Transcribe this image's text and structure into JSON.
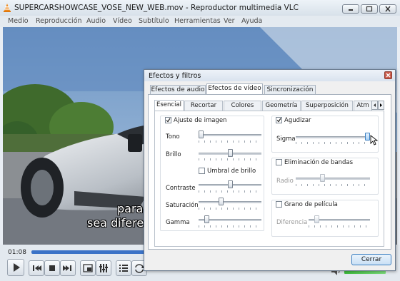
{
  "window": {
    "title": "SUPERCARSHOWCASE_VOSE_NEW_WEB.mov - Reproductor multimedia VLC"
  },
  "menu": {
    "items": [
      "Medio",
      "Reproducción",
      "Audio",
      "Vídeo",
      "Subtítulo",
      "Herramientas",
      "Ver",
      "Ayuda"
    ]
  },
  "video": {
    "subtitle_lines": [
      "para",
      "sea difere"
    ]
  },
  "player": {
    "time_elapsed": "01:08",
    "volume_level": 1.0
  },
  "dialog": {
    "title": "Efectos y filtros",
    "tabs": [
      "Efectos de audio",
      "Efectos de vídeo",
      "Sincronización"
    ],
    "active_tab": "Efectos de vídeo",
    "subtabs": [
      "Esencial",
      "Recortar",
      "Colores",
      "Geometría",
      "Superposición",
      "Atm"
    ],
    "active_subtab": "Esencial",
    "image_adjust": {
      "label": "Ajuste de imagen",
      "checked": true,
      "sliders": [
        {
          "label": "Tono",
          "level": 0.0
        },
        {
          "label": "Brillo",
          "level": 0.5
        },
        {
          "label": "Contraste",
          "level": 0.5
        },
        {
          "label": "Saturación",
          "level": 0.35
        },
        {
          "label": "Gamma",
          "level": 0.1
        }
      ],
      "threshold_label": "Umbral de brillo",
      "threshold_checked": false
    },
    "sharpen": {
      "label": "Agudizar",
      "checked": true,
      "sigma_label": "Sigma",
      "sigma_level": 1.0
    },
    "debanding": {
      "label": "Eliminación de bandas",
      "checked": false,
      "radius_label": "Radio",
      "radius_level": 0.35
    },
    "film_grain": {
      "label": "Grano de película",
      "checked": false,
      "variance_label": "Diferencia",
      "variance_level": 0.1
    },
    "close_label": "Cerrar"
  }
}
